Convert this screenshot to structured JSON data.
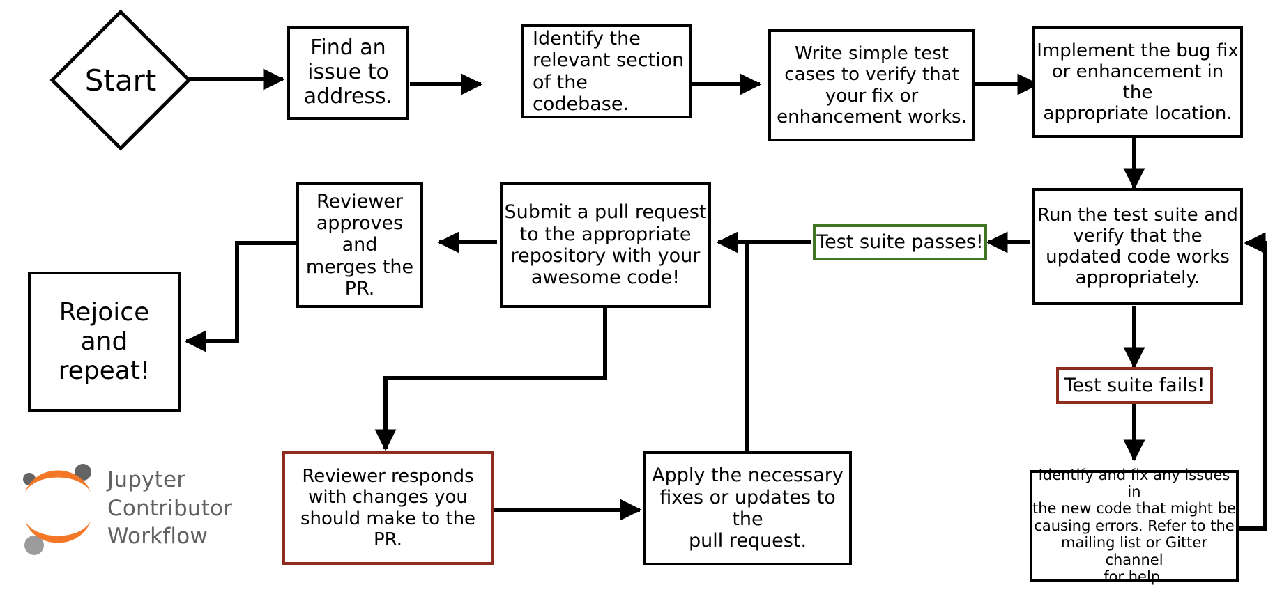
{
  "diagram": {
    "title": "Jupyter Contributor Workflow",
    "type": "flowchart",
    "colors": {
      "stroke": "#000000",
      "background": "#ffffff",
      "success": "#3f7523",
      "failure": "#8e2c1e",
      "brand_orange": "#f37726",
      "brand_gray": "#616161",
      "dot_dark_gray": "#646464",
      "dot_light_gray": "#9b9b9b"
    }
  },
  "brand": {
    "name": "jupyter-logo",
    "text": "Jupyter\nContributor\nWorkflow"
  },
  "nodes": {
    "start": {
      "label": "Start",
      "shape": "diamond"
    },
    "find_issue": {
      "label": "Find an\nissue to\naddress.",
      "shape": "rect"
    },
    "identify_section": {
      "label": "Identify the\nrelevant section\nof the codebase.",
      "shape": "rect"
    },
    "write_tests": {
      "label": "Write simple test\ncases to verify that\nyour fix or\nenhancement works.",
      "shape": "rect"
    },
    "implement_fix": {
      "label": "Implement the bug fix\nor enhancement in the\nappropriate location.",
      "shape": "rect"
    },
    "run_tests": {
      "label": "Run the test suite and\nverify that the\nupdated code works\nappropriately.",
      "shape": "rect"
    },
    "tests_pass": {
      "label": "Test suite passes!",
      "shape": "rect",
      "state": "success"
    },
    "tests_fail": {
      "label": "Test suite fails!",
      "shape": "rect",
      "state": "failure"
    },
    "fix_issues": {
      "label": "Identify and fix any issues in\nthe new code that might be\ncausing errors. Refer to the\nmailing list or Gitter channel\nfor help.",
      "shape": "rect"
    },
    "submit_pr": {
      "label": "Submit a pull request\nto the appropriate\nrepository with your\nawesome code!",
      "shape": "rect"
    },
    "reviewer_approves": {
      "label": "Reviewer\napproves and\nmerges the\nPR.",
      "shape": "rect"
    },
    "rejoice": {
      "label": "Rejoice\nand\nrepeat!",
      "shape": "rect"
    },
    "reviewer_responds": {
      "label": "Reviewer responds\nwith changes you\nshould make to the\nPR.",
      "shape": "rect",
      "state": "failure"
    },
    "apply_fixes": {
      "label": "Apply the necessary\nfixes or updates to the\npull request.",
      "shape": "rect"
    }
  },
  "edges": [
    {
      "name": "start-to-find-issue",
      "from": "start",
      "to": "find_issue"
    },
    {
      "name": "find-issue-to-identify-section",
      "from": "find_issue",
      "to": "identify_section"
    },
    {
      "name": "identify-section-to-write-tests",
      "from": "identify_section",
      "to": "write_tests"
    },
    {
      "name": "write-tests-to-implement-fix",
      "from": "write_tests",
      "to": "implement_fix"
    },
    {
      "name": "implement-fix-to-run-tests",
      "from": "implement_fix",
      "to": "run_tests"
    },
    {
      "name": "run-tests-to-tests-pass",
      "from": "run_tests",
      "to": "tests_pass"
    },
    {
      "name": "tests-pass-to-submit-pr",
      "from": "tests_pass",
      "to": "submit_pr"
    },
    {
      "name": "run-tests-to-tests-fail",
      "from": "run_tests",
      "to": "tests_fail"
    },
    {
      "name": "tests-fail-to-fix-issues",
      "from": "tests_fail",
      "to": "fix_issues"
    },
    {
      "name": "fix-issues-to-run-tests",
      "from": "fix_issues",
      "to": "run_tests"
    },
    {
      "name": "submit-pr-to-reviewer-approves",
      "from": "submit_pr",
      "to": "reviewer_approves"
    },
    {
      "name": "reviewer-approves-to-rejoice",
      "from": "reviewer_approves",
      "to": "rejoice"
    },
    {
      "name": "submit-pr-to-reviewer-responds",
      "from": "submit_pr",
      "to": "reviewer_responds"
    },
    {
      "name": "reviewer-responds-to-apply-fixes",
      "from": "reviewer_responds",
      "to": "apply_fixes"
    },
    {
      "name": "apply-fixes-to-submit-pr",
      "from": "apply_fixes",
      "to": "submit_pr"
    }
  ]
}
